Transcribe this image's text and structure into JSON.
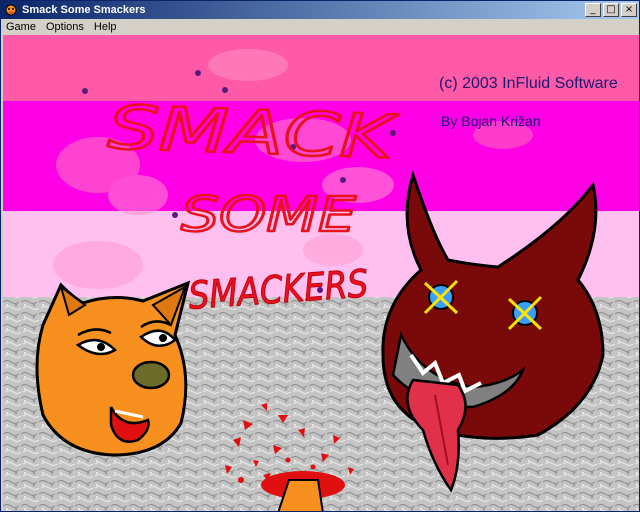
{
  "window": {
    "title": "Smack Some Smackers",
    "buttons": {
      "minimize": "_",
      "maximize": "□",
      "close": "×"
    }
  },
  "menu": [
    {
      "label": "Game"
    },
    {
      "label": "Options"
    },
    {
      "label": "Help"
    }
  ],
  "title_screen": {
    "logo_lines": [
      "SMACK",
      "SOME",
      "SMACKERS"
    ],
    "copyright": "(c) 2003 InFluid Software",
    "author": "By Bojan Križan",
    "characters": [
      "pig",
      "devil"
    ]
  },
  "colors": {
    "title_bar_start": "#0a246a",
    "title_bar_end": "#a6caf0",
    "band_top": "#ff5aa8",
    "band_middle": "#ff00e6",
    "band_lower": "#ffc0f0",
    "wall": "#c8c8c8",
    "logo_red": "#e8121e",
    "pig_orange": "#f7901e",
    "devil_red": "#7a0a0a",
    "blood": "#e01010",
    "text": "#1a1a6e"
  }
}
